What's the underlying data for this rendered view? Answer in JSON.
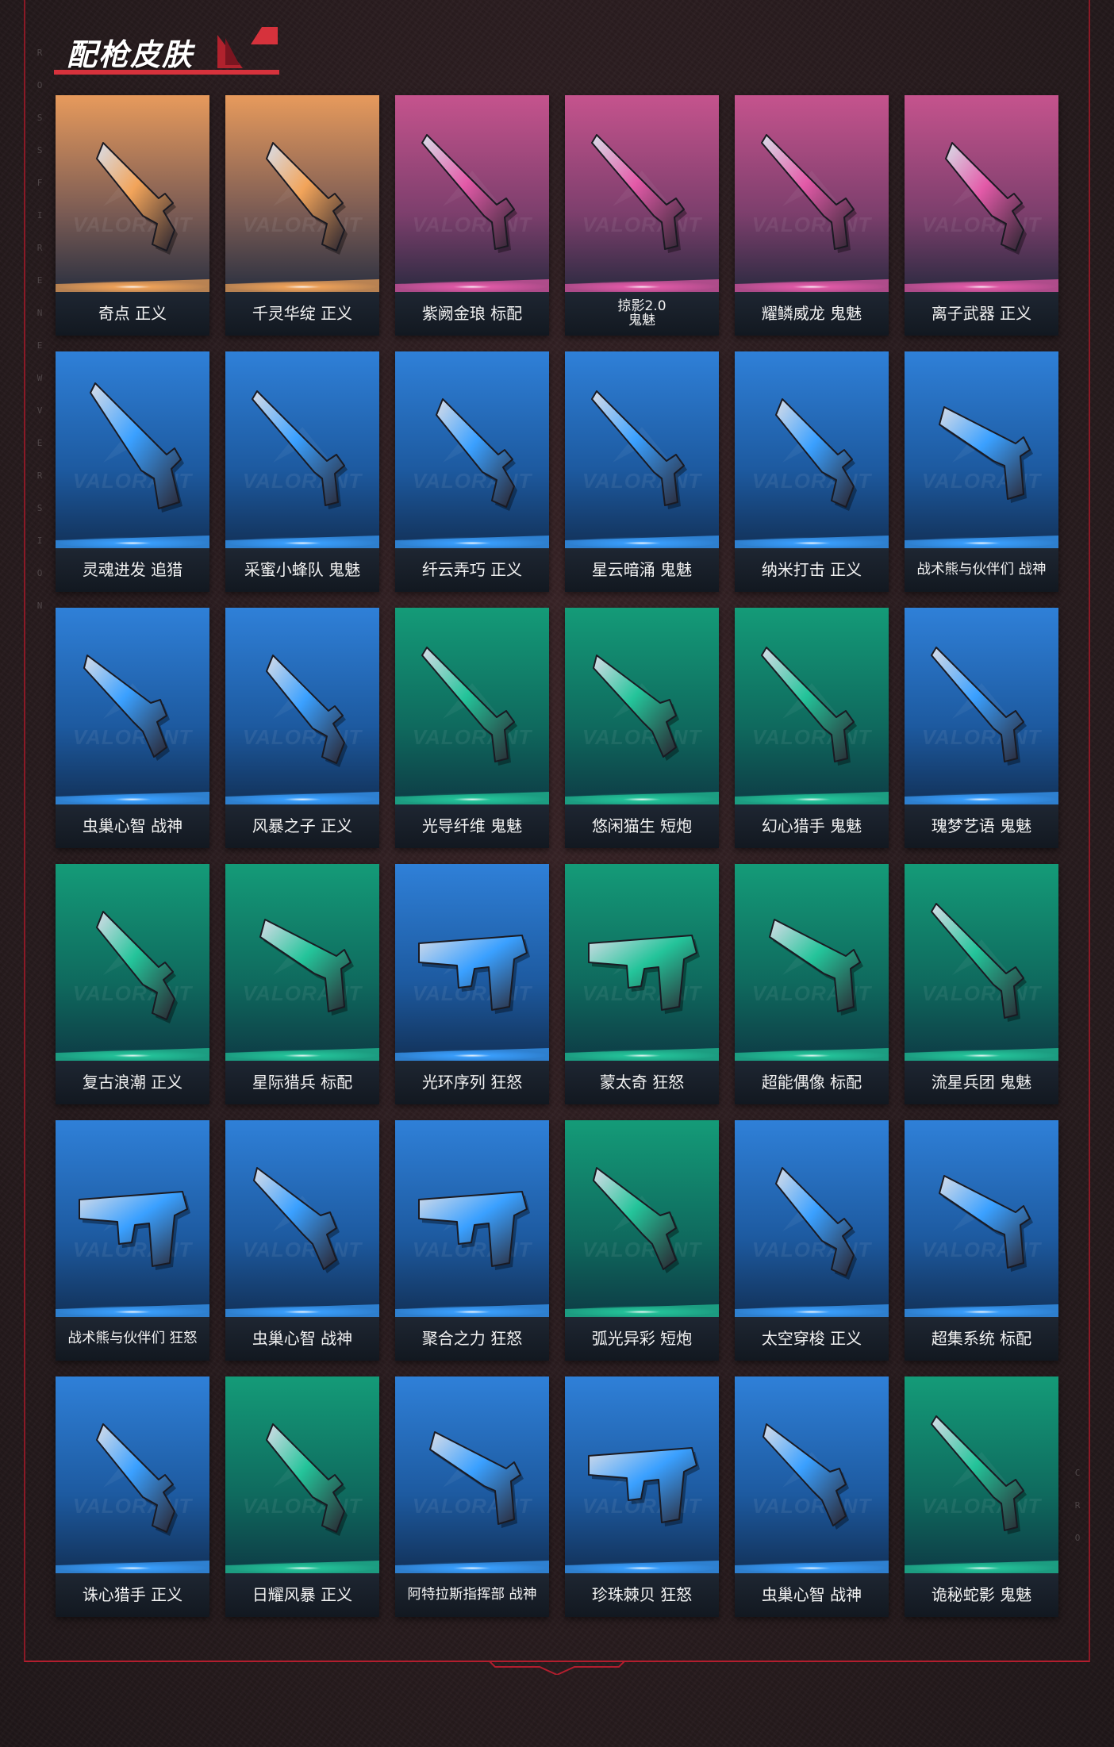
{
  "header": {
    "title": "配枪皮肤",
    "side_letters_left": [
      "R",
      "O",
      "S",
      "S",
      "F",
      "I",
      "R",
      "E",
      "N",
      "E",
      "W",
      "V",
      "E",
      "R",
      "S",
      "I",
      "O",
      "N"
    ],
    "side_letters_right": [
      "C",
      "R",
      "O"
    ]
  },
  "watermark": "VALORANT",
  "colors": {
    "orange": "#e89858",
    "pink": "#c0508a",
    "blue": "#2a72c8",
    "teal": "#169a78",
    "accent_red": "#d6323c"
  },
  "skins": [
    {
      "name": "奇点 正义",
      "tier": "orange",
      "weapon": "sheriff"
    },
    {
      "name": "千灵华绽 正义",
      "tier": "orange",
      "weapon": "sheriff"
    },
    {
      "name": "紫阙金琅 标配",
      "tier": "pink",
      "weapon": "ghost"
    },
    {
      "name": "掠影2.0",
      "sub": "鬼魅",
      "tier": "pink",
      "weapon": "ghost"
    },
    {
      "name": "耀鳞威龙 鬼魅",
      "tier": "pink",
      "weapon": "ghost"
    },
    {
      "name": "离子武器 正义",
      "tier": "pink",
      "weapon": "sheriff"
    },
    {
      "name": "灵魂进发 追猎",
      "tier": "blue",
      "weapon": "marshal"
    },
    {
      "name": "采蜜小蜂队 鬼魅",
      "tier": "blue",
      "weapon": "ghost"
    },
    {
      "name": "纤云弄巧 正义",
      "tier": "blue",
      "weapon": "sheriff"
    },
    {
      "name": "星云暗涌 鬼魅",
      "tier": "blue",
      "weapon": "ghost"
    },
    {
      "name": "纳米打击 正义",
      "tier": "blue",
      "weapon": "sheriff"
    },
    {
      "name": "战术熊与伙伴们 战神",
      "tier": "blue",
      "weapon": "classic",
      "small": true
    },
    {
      "name": "虫巢心智 战神",
      "tier": "blue",
      "weapon": "shorty"
    },
    {
      "name": "风暴之子 正义",
      "tier": "blue",
      "weapon": "sheriff"
    },
    {
      "name": "光导纤维 鬼魅",
      "tier": "teal",
      "weapon": "ghost"
    },
    {
      "name": "悠闲猫生 短炮",
      "tier": "teal",
      "weapon": "shorty"
    },
    {
      "name": "幻心猎手 鬼魅",
      "tier": "teal",
      "weapon": "ghost"
    },
    {
      "name": "瑰梦艺语 鬼魅",
      "tier": "blue",
      "weapon": "ghost"
    },
    {
      "name": "复古浪潮 正义",
      "tier": "teal",
      "weapon": "sheriff"
    },
    {
      "name": "星际猎兵 标配",
      "tier": "teal",
      "weapon": "classic"
    },
    {
      "name": "光环序列 狂怒",
      "tier": "blue",
      "weapon": "frenzy"
    },
    {
      "name": "蒙太奇 狂怒",
      "tier": "teal",
      "weapon": "frenzy"
    },
    {
      "name": "超能偶像 标配",
      "tier": "teal",
      "weapon": "classic"
    },
    {
      "name": "流星兵团 鬼魅",
      "tier": "teal",
      "weapon": "ghost"
    },
    {
      "name": "战术熊与伙伴们 狂怒",
      "tier": "blue",
      "weapon": "frenzy",
      "small": true
    },
    {
      "name": "虫巢心智 战神",
      "tier": "blue",
      "weapon": "shorty"
    },
    {
      "name": "聚合之力 狂怒",
      "tier": "blue",
      "weapon": "frenzy"
    },
    {
      "name": "弧光异彩 短炮",
      "tier": "teal",
      "weapon": "shorty"
    },
    {
      "name": "太空穿梭 正义",
      "tier": "blue",
      "weapon": "sheriff"
    },
    {
      "name": "超集系统 标配",
      "tier": "blue",
      "weapon": "classic"
    },
    {
      "name": "诛心猎手 正义",
      "tier": "blue",
      "weapon": "sheriff"
    },
    {
      "name": "日耀风暴 正义",
      "tier": "teal",
      "weapon": "sheriff"
    },
    {
      "name": "阿特拉斯指挥部 战神",
      "tier": "blue",
      "weapon": "classic",
      "small": true
    },
    {
      "name": "珍珠棘贝 狂怒",
      "tier": "blue",
      "weapon": "frenzy"
    },
    {
      "name": "虫巢心智 战神",
      "tier": "blue",
      "weapon": "shorty"
    },
    {
      "name": "诡秘蛇影 鬼魅",
      "tier": "teal",
      "weapon": "ghost"
    }
  ]
}
